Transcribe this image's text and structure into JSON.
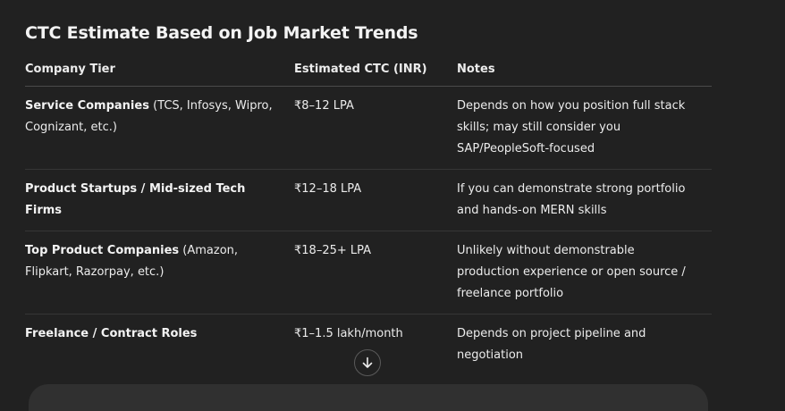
{
  "section": {
    "title": "CTC Estimate Based on Job Market Trends"
  },
  "table": {
    "headers": [
      "Company Tier",
      "Estimated CTC (INR)",
      "Notes"
    ],
    "rows": [
      {
        "tier_bold": "Service Companies",
        "tier_rest": " (TCS, Infosys, Wipro, Cognizant, etc.)",
        "ctc": "₹8–12 LPA",
        "notes": "Depends on how you position full stack skills; may still consider you SAP/PeopleSoft-focused"
      },
      {
        "tier_bold": "Product Startups / Mid-sized Tech Firms",
        "tier_rest": "",
        "ctc": "₹12–18 LPA",
        "notes": "If you can demonstrate strong portfolio and hands-on MERN skills"
      },
      {
        "tier_bold": "Top Product Companies",
        "tier_rest": " (Amazon, Flipkart, Razorpay, etc.)",
        "ctc": "₹18–25+ LPA",
        "notes": "Unlikely without demonstrable production experience or open source / freelance portfolio"
      },
      {
        "tier_bold": "Freelance / Contract Roles",
        "tier_rest": "",
        "ctc": "₹1–1.5 lakh/month",
        "notes": "Depends on project pipeline and negotiation"
      }
    ]
  },
  "icons": {
    "scroll_down": "arrow-down-icon"
  },
  "colors": {
    "background": "#212121",
    "text": "#ececec",
    "divider": "#363636"
  }
}
